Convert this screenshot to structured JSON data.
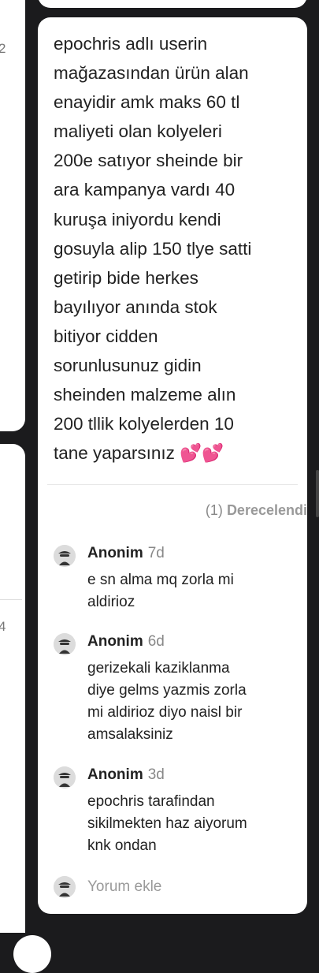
{
  "left_column": {
    "num_top": "2",
    "num_bottom": "4"
  },
  "post": {
    "text": "epochris adlı userin\nmağazasından ürün alan\nenayidir amk maks 60 tl\nmaliyeti olan kolyeleri\n200e satıyor sheinde bir\nara kampanya vardı 40\nkuruşa iniyordu kendi\ngosuyla alip 150 tlye satti\ngetirip bide herkes\nbayılıyor anında stok\nbitiyor cidden\nsorunlusunuz gidin\nsheinden malzeme alın\n200 tllik kolyelerden 10\ntane yaparsınız 💕💕",
    "rating_count": "(1)",
    "rating_label": "Derecelendi"
  },
  "comments": [
    {
      "author": "Anonim",
      "time": "7d",
      "text": "e sn alma mq zorla mi\naldirioz"
    },
    {
      "author": "Anonim",
      "time": "6d",
      "text": "gerizekali kaziklanma\ndiye gelms yazmis zorla\nmi aldirioz diyo naisl bir\namsalaksiniz"
    },
    {
      "author": "Anonim",
      "time": "3d",
      "text": "epochris tarafindan\nsikilmekten haz aiyorum\nknk ondan"
    }
  ],
  "add_comment_placeholder": "Yorum ekle",
  "colors": {
    "background": "#1b1b1d",
    "card": "#ffffff",
    "text": "#222222",
    "muted": "#888888"
  },
  "icons": {
    "avatar": "anonymous-avatar-icon"
  }
}
